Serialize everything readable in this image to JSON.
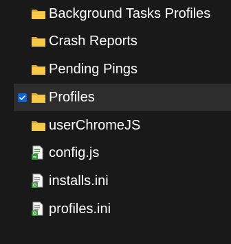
{
  "items": [
    {
      "label": "Background Tasks Profiles",
      "icon": "folder-icon",
      "selected": false,
      "checked": false
    },
    {
      "label": "Crash Reports",
      "icon": "folder-icon",
      "selected": false,
      "checked": false
    },
    {
      "label": "Pending Pings",
      "icon": "folder-icon",
      "selected": false,
      "checked": false
    },
    {
      "label": "Profiles",
      "icon": "folder-icon",
      "selected": true,
      "checked": true
    },
    {
      "label": "userChromeJS",
      "icon": "folder-icon",
      "selected": false,
      "checked": false
    },
    {
      "label": "config.js",
      "icon": "script-file-icon",
      "selected": false,
      "checked": false
    },
    {
      "label": "installs.ini",
      "icon": "settings-file-icon",
      "selected": false,
      "checked": false
    },
    {
      "label": "profiles.ini",
      "icon": "settings-file-icon",
      "selected": false,
      "checked": false
    }
  ],
  "colors": {
    "background": "#191919",
    "selected_row": "#2d2d2d",
    "checkbox": "#0a64d8",
    "folder": "#f7c948",
    "text": "#ffffff"
  }
}
